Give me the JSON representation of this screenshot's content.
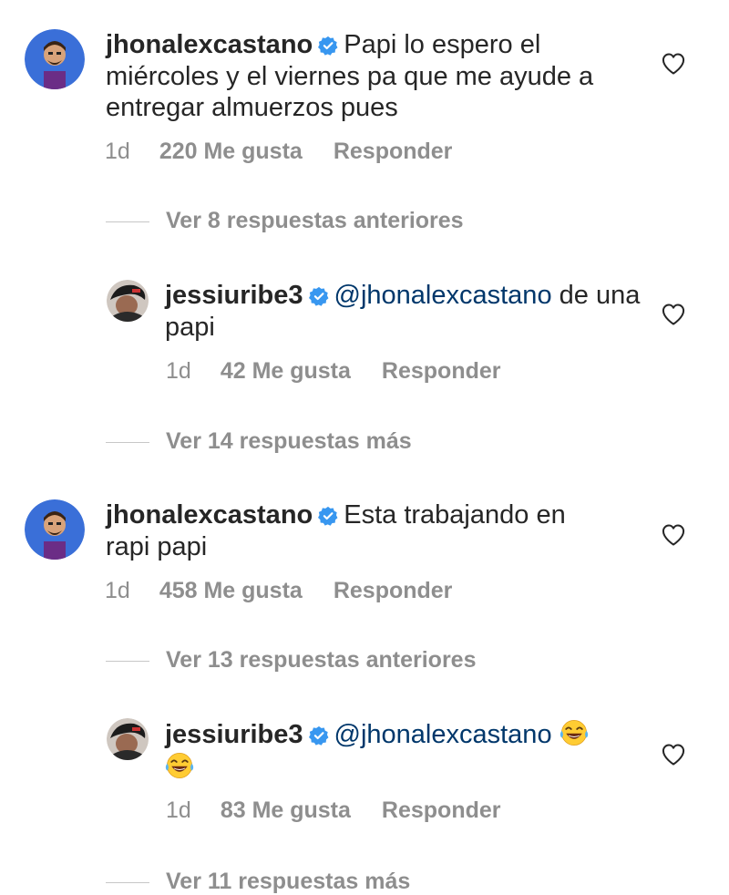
{
  "comments": [
    {
      "username": "jhonalexcastano",
      "mention": "",
      "text": "Papi lo espero el miércoles y el viernes pa que me ayude a entregar almuerzos pues",
      "time": "1d",
      "likes": "220 Me gusta",
      "reply": "Responder",
      "avatar_icon": "bitmoji-avatar-icon"
    },
    {
      "username": "jessiuribe3",
      "mention": "@jhonalexcastano",
      "text": " de una papi",
      "time": "1d",
      "likes": "42 Me gusta",
      "reply": "Responder",
      "avatar_icon": "profile-photo-avatar-icon"
    },
    {
      "username": "jhonalexcastano",
      "mention": "",
      "text": "Esta trabajando en rapi papi",
      "time": "1d",
      "likes": "458 Me gusta",
      "reply": "Responder",
      "avatar_icon": "bitmoji-avatar-icon"
    },
    {
      "username": "jessiuribe3",
      "mention": "@jhonalexcastano",
      "text": "",
      "emojis": "laughing-tears-emoji x2",
      "time": "1d",
      "likes": "83 Me gusta",
      "reply": "Responder",
      "avatar_icon": "profile-photo-avatar-icon"
    }
  ],
  "threads": [
    "Ver 8 respuestas anteriores",
    "Ver 14 respuestas más",
    "Ver 13 respuestas anteriores",
    "Ver 11 respuestas más"
  ],
  "colors": {
    "text": "#262626",
    "meta": "#8e8e8e",
    "verified": "#3897f0",
    "mention": "#00376b"
  }
}
